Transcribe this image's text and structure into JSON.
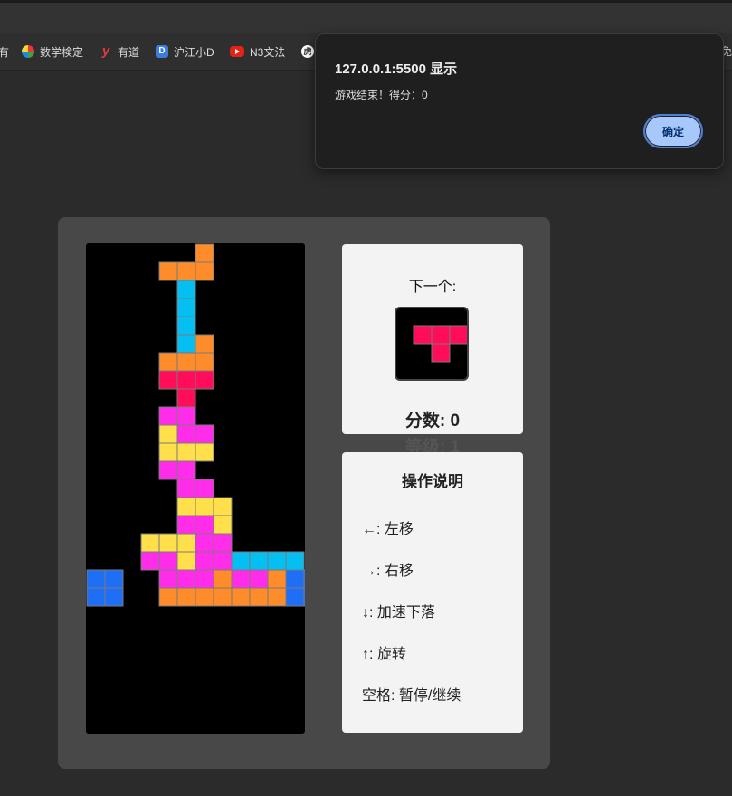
{
  "browser": {
    "bookmarks": [
      {
        "label": "有",
        "icon": "none"
      },
      {
        "label": "数学検定",
        "icon": "math-logo-icon"
      },
      {
        "label": "有道",
        "icon": "youdao-icon"
      },
      {
        "label": "沪江小D",
        "icon": "hujiang-icon"
      },
      {
        "label": "N3文法",
        "icon": "youtube-icon"
      },
      {
        "label": "",
        "icon": "chinese-char-icon"
      }
    ],
    "overflow_text": "免"
  },
  "dialog": {
    "title": "127.0.0.1:5500 显示",
    "message": "游戏结束！得分：0",
    "ok_label": "确定",
    "button_color": "#a8c7fa"
  },
  "game": {
    "next_label": "下一个:",
    "score_text": "分数: 0",
    "level_text": "等级: 1",
    "help_title": "操作说明",
    "help_items": [
      "←: 左移",
      "→: 右移",
      "↓: 加速下落",
      "↑: 旋转",
      "空格: 暂停/继续"
    ],
    "colors": {
      "O": "#ff8c2a",
      "I": "#05bff2",
      "T": "#ff0c5b",
      "S": "#ff2dea",
      "Y": "#ffe04a",
      "B": "#1e6ff5"
    },
    "board": [
      "......O...",
      "....OOO...",
      ".....I....",
      ".....I....",
      ".....I....",
      ".....IO...",
      "....OOO...",
      "....TTT...",
      ".....T....",
      "....SS....",
      "....YSS...",
      "....YYY...",
      "....SS....",
      ".....SS...",
      ".....YYY..",
      ".....SSY..",
      "...YYYSS..",
      "...SSYSSIIII",
      "BB..SSSOSSOBB",
      "BB..OOOOOOOBB"
    ],
    "next_piece": [
      "TTT",
      ".T."
    ]
  }
}
